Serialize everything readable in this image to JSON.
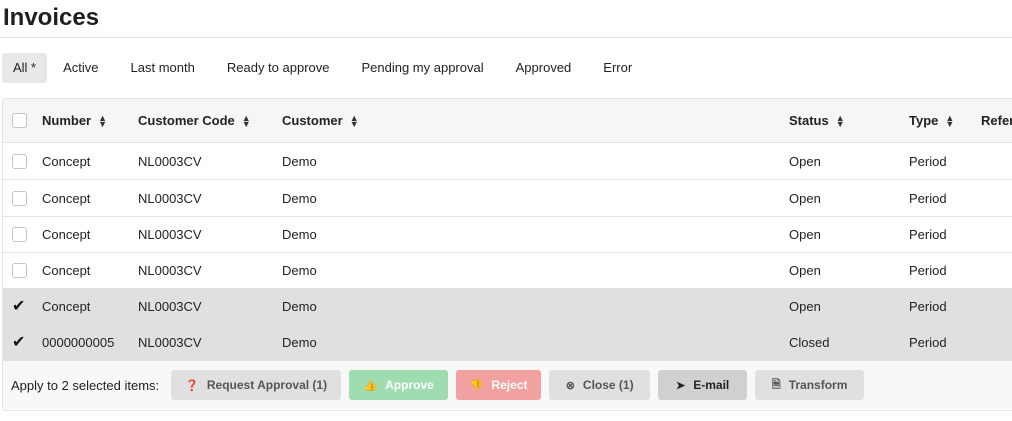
{
  "page": {
    "title": "Invoices"
  },
  "tabs": [
    {
      "label": "All *",
      "active": true
    },
    {
      "label": "Active"
    },
    {
      "label": "Last month"
    },
    {
      "label": "Ready to approve"
    },
    {
      "label": "Pending my approval"
    },
    {
      "label": "Approved"
    },
    {
      "label": "Error"
    }
  ],
  "table": {
    "columns": [
      "Number",
      "Customer Code",
      "Customer",
      "Status",
      "Type",
      "Refer"
    ],
    "rows": [
      {
        "selected": false,
        "number": "Concept",
        "customer_code": "NL0003CV",
        "customer": "Demo",
        "status": "Open",
        "type": "Period"
      },
      {
        "selected": false,
        "number": "Concept",
        "customer_code": "NL0003CV",
        "customer": "Demo",
        "status": "Open",
        "type": "Period"
      },
      {
        "selected": false,
        "number": "Concept",
        "customer_code": "NL0003CV",
        "customer": "Demo",
        "status": "Open",
        "type": "Period"
      },
      {
        "selected": false,
        "number": "Concept",
        "customer_code": "NL0003CV",
        "customer": "Demo",
        "status": "Open",
        "type": "Period"
      },
      {
        "selected": true,
        "number": "Concept",
        "customer_code": "NL0003CV",
        "customer": "Demo",
        "status": "Open",
        "type": "Period"
      },
      {
        "selected": true,
        "number": "0000000005",
        "customer_code": "NL0003CV",
        "customer": "Demo",
        "status": "Closed",
        "type": "Period"
      }
    ]
  },
  "bulk_actions": {
    "label": "Apply to 2 selected items:",
    "buttons": [
      {
        "label": "Request Approval (1)",
        "icon": "question-circle-icon"
      },
      {
        "label": "Approve",
        "icon": "thumbs-up-icon",
        "color": "#9fdcb0"
      },
      {
        "label": "Reject",
        "icon": "thumbs-down-icon",
        "color": "#f2a1a1"
      },
      {
        "label": "Close (1)",
        "icon": "close-circle-icon"
      },
      {
        "label": "E-mail",
        "icon": "paper-plane-icon"
      },
      {
        "label": "Transform",
        "icon": "file-icon"
      }
    ]
  }
}
